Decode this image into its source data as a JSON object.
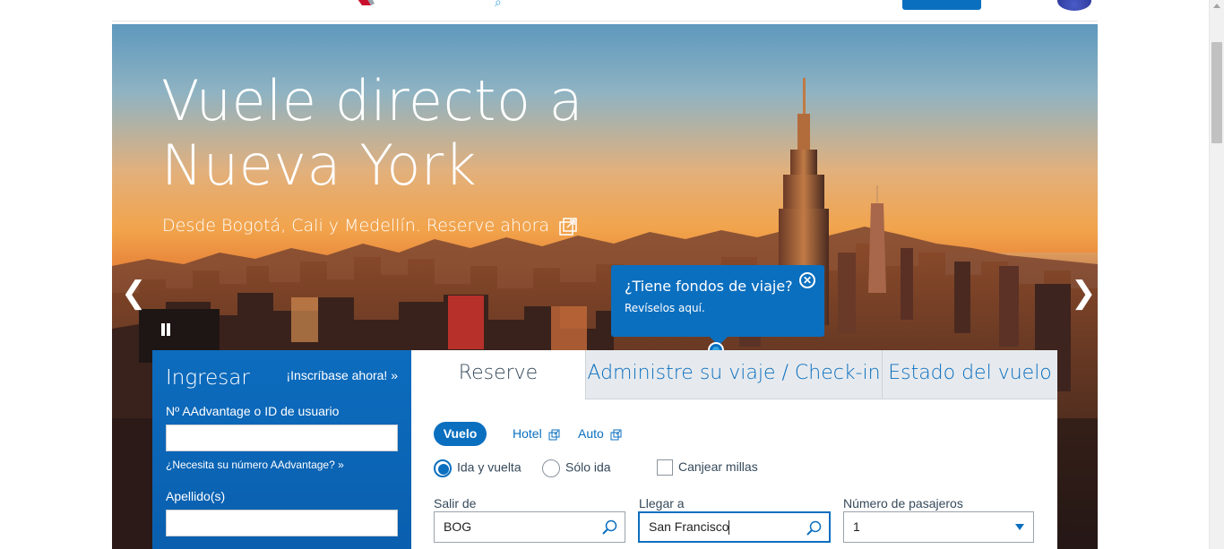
{
  "hero": {
    "title_line1": "Vuele directo a",
    "title_line2": "Nueva York",
    "subtitle": "Desde Bogotá, Cali y Medellín. Reserve ahora",
    "prev_glyph": "❮",
    "next_glyph": "❯"
  },
  "tooltip": {
    "title": "¿Tiene fondos de viaje?",
    "body": "Revíselos aquí.",
    "close_glyph": "✕"
  },
  "login": {
    "title": "Ingresar",
    "signup_link": "¡Inscríbase ahora! »",
    "user_label": "Nº AAdvantage o ID de usuario",
    "user_value": "",
    "help_link": "¿Necesita su número AAdvantage? »",
    "lastname_label": "Apellido(s)",
    "lastname_value": ""
  },
  "booking": {
    "tabs": [
      {
        "label": "Reserve"
      },
      {
        "label": "Administre su viaje / Check-in"
      },
      {
        "label": "Estado del vuelo"
      }
    ],
    "product_tabs": {
      "flight": "Vuelo",
      "hotel": "Hotel",
      "car": "Auto"
    },
    "trip_type": {
      "round_trip": "Ida y vuelta",
      "one_way": "Sólo ida",
      "redeem_miles": "Canjear millas"
    },
    "origin": {
      "label": "Salir de",
      "value": "BOG"
    },
    "destination": {
      "label": "Llegar a",
      "value": "San Francisco"
    },
    "passengers": {
      "label": "Número de pasajeros",
      "value": "1"
    }
  },
  "colors": {
    "brand_blue": "#0b6fbf",
    "accent_blue": "#36a5de",
    "text_dark": "#36495a"
  }
}
